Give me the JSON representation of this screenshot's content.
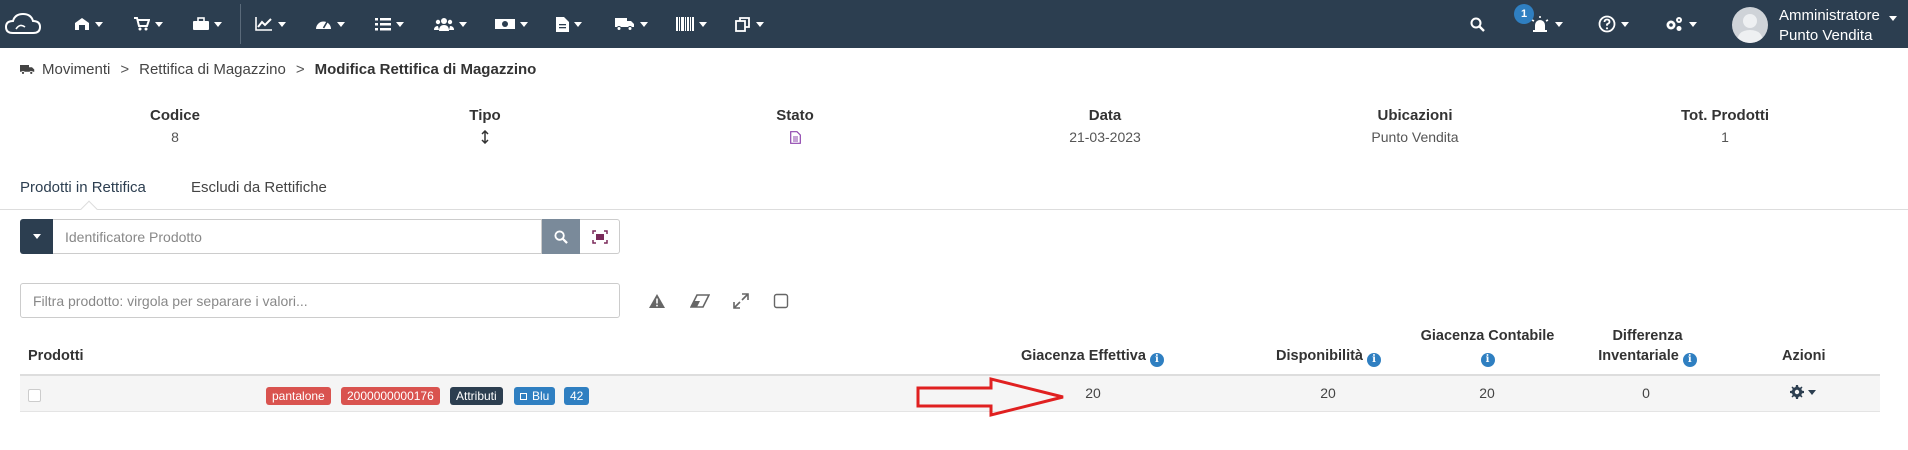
{
  "topbar": {
    "notification_count": "1",
    "user": {
      "line1": "Amministratore",
      "line2": "Punto Vendita"
    },
    "icons": [
      "cloud-logo-icon",
      "warehouse-icon",
      "cart-icon",
      "briefcase-icon",
      "line-chart-icon",
      "dashboard-icon",
      "list-icon",
      "users-icon",
      "money-icon",
      "document-icon",
      "truck-icon",
      "barcode-icon",
      "copy-icon",
      "search-icon",
      "alarm-icon",
      "help-icon",
      "cogs-icon"
    ]
  },
  "breadcrumb": {
    "items": [
      "Movimenti",
      "Rettifica di Magazzino",
      "Modifica Rettifica di Magazzino"
    ],
    "separator": ">"
  },
  "summary": {
    "codice": {
      "label": "Codice",
      "value": "8"
    },
    "tipo": {
      "label": "Tipo",
      "value_icon": "arrows-vertical-icon"
    },
    "stato": {
      "label": "Stato",
      "value_icon": "document-icon"
    },
    "data": {
      "label": "Data",
      "value": "21-03-2023"
    },
    "ubicazioni": {
      "label": "Ubicazioni",
      "value": "Punto Vendita"
    },
    "tot_prodotti": {
      "label": "Tot. Prodotti",
      "value": "1"
    }
  },
  "tabs": [
    "Prodotti in Rettifica",
    "Escludi da Rettifiche"
  ],
  "search": {
    "placeholder": "Identificatore Prodotto"
  },
  "filter": {
    "placeholder": "Filtra prodotto: virgola per separare i valori..."
  },
  "table": {
    "headers": {
      "prodotti": "Prodotti",
      "giacenza_effettiva": "Giacenza Effettiva",
      "disponibilita": "Disponibilità",
      "giacenza_contabile": "Giacenza Contabile",
      "differenza_line1": "Differenza",
      "differenza_line2": "Inventariale",
      "azioni": "Azioni"
    },
    "rows": [
      {
        "tags": [
          "pantalone",
          "2000000000176",
          "Attributi",
          "Blu",
          "42"
        ],
        "giacenza_effettiva": "20",
        "disponibilita": "20",
        "giacenza_contabile": "20",
        "differenza": "0"
      }
    ]
  },
  "colors": {
    "navbar": "#2c3e50",
    "tag_red": "#d9534f",
    "tag_dark": "#2c3e50",
    "tag_blue": "#2f7fc1",
    "annotation_arrow": "#e02020"
  }
}
